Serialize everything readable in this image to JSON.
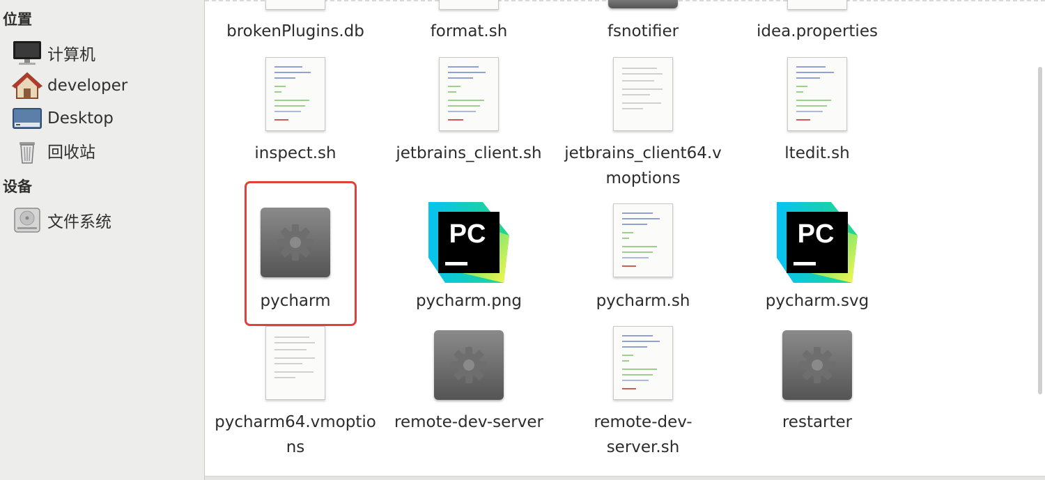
{
  "sidebar": {
    "places_header": "位置",
    "places": [
      {
        "label": "计算机",
        "icon": "computer-icon"
      },
      {
        "label": "developer",
        "icon": "home-folder-icon"
      },
      {
        "label": "Desktop",
        "icon": "desktop-icon"
      },
      {
        "label": "回收站",
        "icon": "trash-icon"
      }
    ],
    "devices_header": "设备",
    "devices": [
      {
        "label": "文件系统",
        "icon": "drive-icon"
      }
    ]
  },
  "files": {
    "row0": [
      "brokenPlugins.db",
      "format.sh",
      "fsnotifier",
      "idea.properties"
    ],
    "inspect": "inspect.sh",
    "jb_client": "jetbrains_client.sh",
    "jb_client64_a": "jetbrains_client64.v",
    "jb_client64_b": "moptions",
    "ltedit": "ltedit.sh",
    "pycharm": "pycharm",
    "pycharm_png": "pycharm.png",
    "pycharm_sh": "pycharm.sh",
    "pycharm_svg": "pycharm.svg",
    "vmoptions_a": "pycharm64.vmoptio",
    "vmoptions_b": "ns",
    "rds": "remote-dev-server",
    "rds_sh_a": "remote-dev-",
    "rds_sh_b": "server.sh",
    "restarter": "restarter"
  },
  "logo": {
    "text": "PC"
  },
  "selected_file": "pycharm",
  "colors": {
    "highlight": "#e0423a",
    "logo_bg": "#000000"
  }
}
